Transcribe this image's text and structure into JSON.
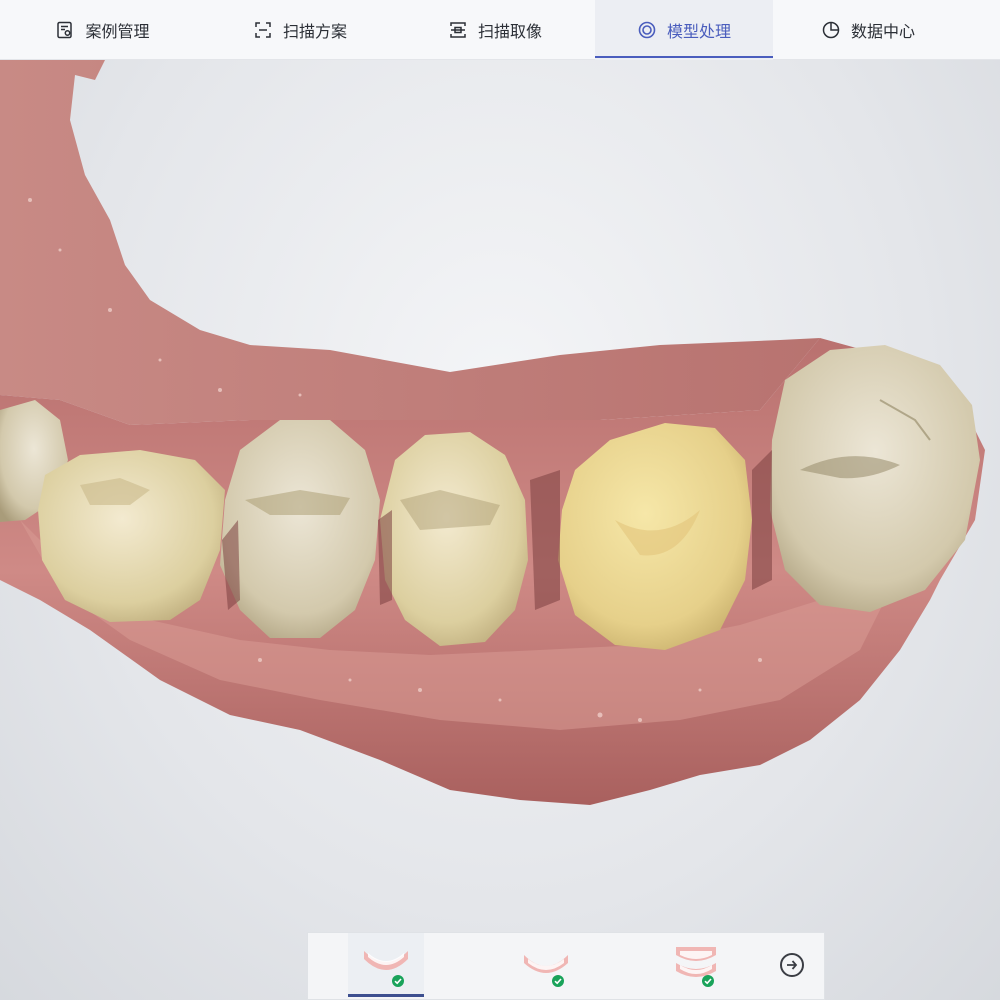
{
  "nav": {
    "tabs": [
      {
        "label": "案例管理",
        "icon": "case-management-icon",
        "active": false
      },
      {
        "label": "扫描方案",
        "icon": "scan-plan-icon",
        "active": false
      },
      {
        "label": "扫描取像",
        "icon": "scan-capture-icon",
        "active": false
      },
      {
        "label": "模型处理",
        "icon": "model-processing-icon",
        "active": true
      },
      {
        "label": "数据中心",
        "icon": "data-center-icon",
        "active": false
      }
    ]
  },
  "viewport": {
    "model": "lower-jaw-3d-scan",
    "background": "#e6e8ec"
  },
  "jaw_selector": {
    "items": [
      {
        "icon": "lower-jaw-icon",
        "completed": true,
        "selected": true
      },
      {
        "icon": "upper-jaw-icon",
        "completed": true,
        "selected": false
      },
      {
        "icon": "bite-icon",
        "completed": true,
        "selected": false
      }
    ],
    "next_icon": "arrow-right-circle-icon"
  },
  "colors": {
    "accent": "#4a5dbd",
    "check": "#19a35a",
    "gum": "#c77a78",
    "tooth": "#e9dcb4"
  }
}
